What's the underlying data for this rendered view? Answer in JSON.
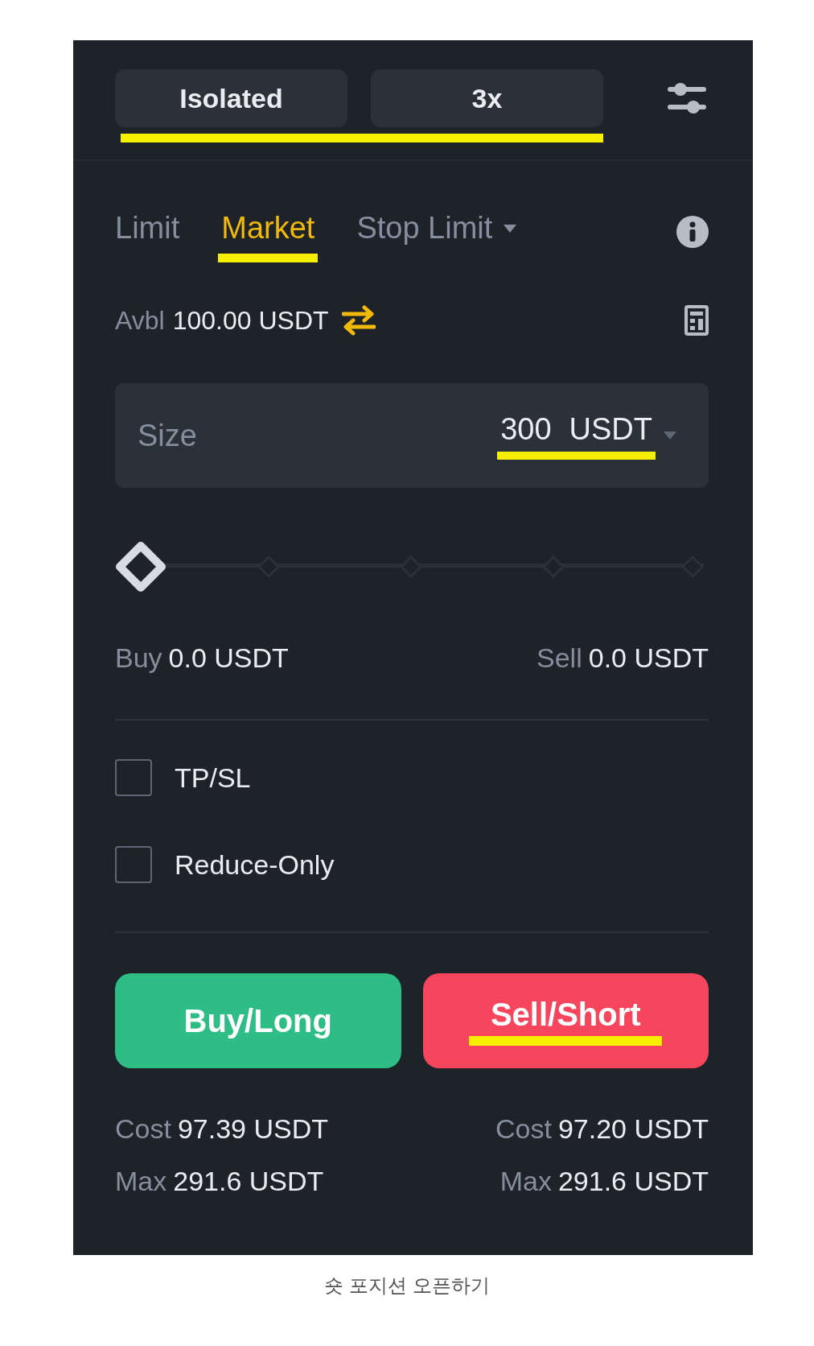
{
  "top_bar": {
    "highlighted": true,
    "buttons": [
      {
        "label": "Isolated"
      },
      {
        "label": "3x"
      }
    ]
  },
  "order_tabs": [
    {
      "label": "Limit",
      "selected": false,
      "dropdown": false
    },
    {
      "label": "Market",
      "selected": true,
      "dropdown": false
    },
    {
      "label": "Stop Limit",
      "selected": false,
      "dropdown": true
    }
  ],
  "available": {
    "label": "Avbl",
    "value": "100.00 USDT"
  },
  "size_field": {
    "label": "Size",
    "value": "300",
    "unit": "USDT",
    "highlighted": true
  },
  "slider": {
    "level": 0
  },
  "amounts": [
    {
      "label": "Buy",
      "value": "0.0 USDT"
    },
    {
      "label": "Sell",
      "value": "0.0 USDT"
    }
  ],
  "options": [
    {
      "label": "TP/SL",
      "checked": false
    },
    {
      "label": "Reduce-Only",
      "checked": false
    }
  ],
  "actions": [
    {
      "label": "Buy/Long",
      "kind": "buy",
      "highlighted": false
    },
    {
      "label": "Sell/Short",
      "kind": "sell",
      "highlighted": true
    }
  ],
  "summary": [
    {
      "cost_label": "Cost",
      "cost": "97.39 USDT",
      "max_label": "Max",
      "max": "291.6 USDT"
    },
    {
      "cost_label": "Cost",
      "cost": "97.20 USDT",
      "max_label": "Max",
      "max": "291.6 USDT"
    }
  ],
  "caption": "숏 포지션 오픈하기"
}
